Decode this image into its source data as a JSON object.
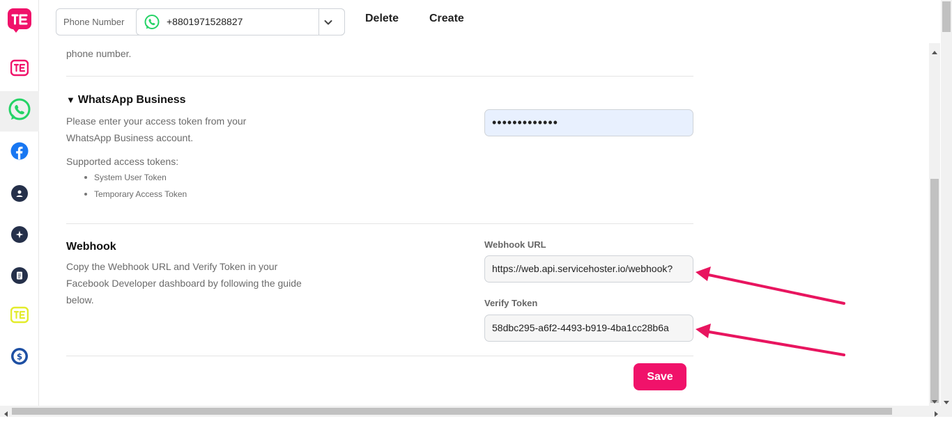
{
  "rail": {
    "items": [
      {
        "icon": "brand-logo-icon"
      },
      {
        "icon": "app-logo-icon"
      },
      {
        "icon": "whatsapp-icon",
        "active": true
      },
      {
        "icon": "facebook-icon"
      },
      {
        "icon": "contacts-icon"
      },
      {
        "icon": "sparkle-icon"
      },
      {
        "icon": "document-icon"
      },
      {
        "icon": "app-logo-yellow-icon"
      },
      {
        "icon": "billing-icon"
      }
    ]
  },
  "topbar": {
    "phone_label": "Phone Number",
    "phone_value": "+8801971528827",
    "delete_label": "Delete",
    "create_label": "Create"
  },
  "intro": {
    "tail_text": "phone number."
  },
  "whatsapp_business": {
    "title": "WhatsApp Business",
    "description_line1": "Please enter your access token from your",
    "description_line2": "WhatsApp Business account.",
    "supported_label": "Supported access tokens:",
    "tokens": [
      "System User Token",
      "Temporary Access Token"
    ],
    "access_token_value": "•••••••••••••"
  },
  "webhook": {
    "title": "Webhook",
    "description_line1": "Copy the Webhook URL and Verify Token in your",
    "description_line2": "Facebook Developer dashboard by following the guide",
    "description_line3": "below.",
    "url_label": "Webhook URL",
    "url_value": "https://web.api.servicehoster.io/webhook?",
    "token_label": "Verify Token",
    "token_value": "58dbc295-a6f2-4493-b919-4ba1cc28b6a"
  },
  "actions": {
    "save_label": "Save"
  },
  "colors": {
    "brand": "#f0126a",
    "whatsapp": "#25d366",
    "facebook": "#1877f2",
    "annotation_arrow": "#e8155f"
  }
}
